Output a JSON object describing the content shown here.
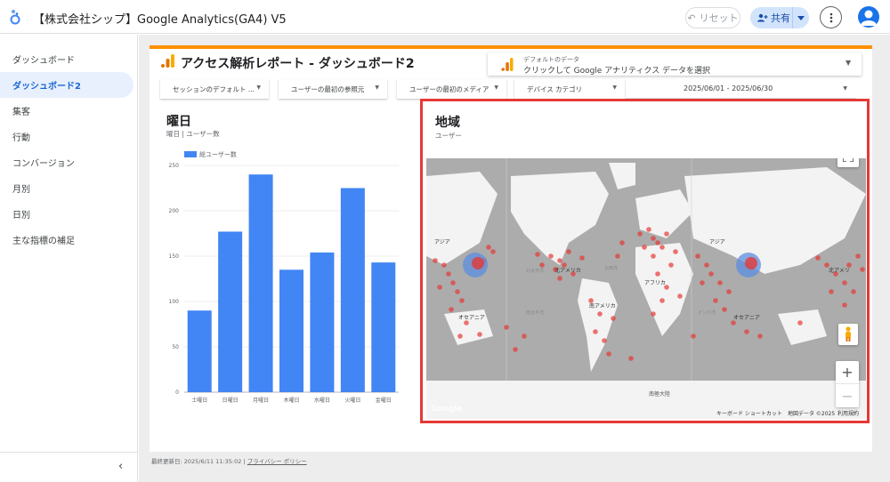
{
  "app": {
    "title": "【株式会社シップ】Google Analytics(GA4) V5",
    "reset_label": "リセット",
    "share_label": "共有"
  },
  "sidebar": {
    "items": [
      {
        "label": "ダッシュボード",
        "active": false
      },
      {
        "label": "ダッシュボード2",
        "active": true
      },
      {
        "label": "集客",
        "active": false
      },
      {
        "label": "行動",
        "active": false
      },
      {
        "label": "コンバージョン",
        "active": false
      },
      {
        "label": "月別",
        "active": false
      },
      {
        "label": "日別",
        "active": false
      },
      {
        "label": "主な指標の補足",
        "active": false
      }
    ],
    "collapse_icon": "‹"
  },
  "report": {
    "title": "アクセス解析レポート - ダッシュボード2",
    "datasource_label": "デフォルトのデータ",
    "datasource_value": "クリックして Google アナリティクス データを選択",
    "filters": [
      "セッションのデフォルト ...",
      "ユーザーの最初の参照元",
      "ユーザーの最初のメディア",
      "デバイス カテゴリ"
    ],
    "date_range": "2025/06/01 - 2025/06/30",
    "footer_updated": "最終更新日: 2025/6/11 11:35:02",
    "footer_separator": "|",
    "footer_privacy": "プライバシー ポリシー"
  },
  "bar_panel": {
    "title": "曜日",
    "subtitle": "曜日 | ユーザー数",
    "legend": "総ユーザー数"
  },
  "chart_data": {
    "type": "bar",
    "title": "曜日",
    "categories": [
      "土曜日",
      "日曜日",
      "月曜日",
      "木曜日",
      "水曜日",
      "火曜日",
      "金曜日"
    ],
    "series": [
      {
        "name": "総ユーザー数",
        "values": [
          90,
          177,
          240,
          135,
          154,
          225,
          143
        ]
      }
    ],
    "ylim": [
      0,
      250
    ],
    "yticks": [
      0,
      50,
      100,
      150,
      200,
      250
    ],
    "grid": true,
    "legend_position": "top-left",
    "color": "#4285f4"
  },
  "map_panel": {
    "title": "地域",
    "subtitle": "ユーザー",
    "labels": {
      "asia_left": "アジア",
      "asia_right": "アジア",
      "north_america": "北アメリカ",
      "north_america_right": "北アメリ",
      "south_america": "南アメリカ",
      "africa": "アフリカ",
      "oceania_left": "オセアニア",
      "oceania_right": "オセアニア",
      "antarctica": "南極大陸",
      "ocean_left": "北太平洋",
      "ocean_mid": "大西洋",
      "ocean_sp": "南太平洋",
      "ocean_indian": "インド洋"
    },
    "footer_shortcuts": "キーボード ショートカット",
    "footer_mapdata": "地図データ ©2025",
    "footer_terms": "利用規約",
    "google_logo": "Google"
  },
  "colors": {
    "accent": "#ff8f00",
    "bar": "#4285f4",
    "highlight_border": "#e53935",
    "marker": "#e53935",
    "marker_big": "#5c8de0"
  }
}
